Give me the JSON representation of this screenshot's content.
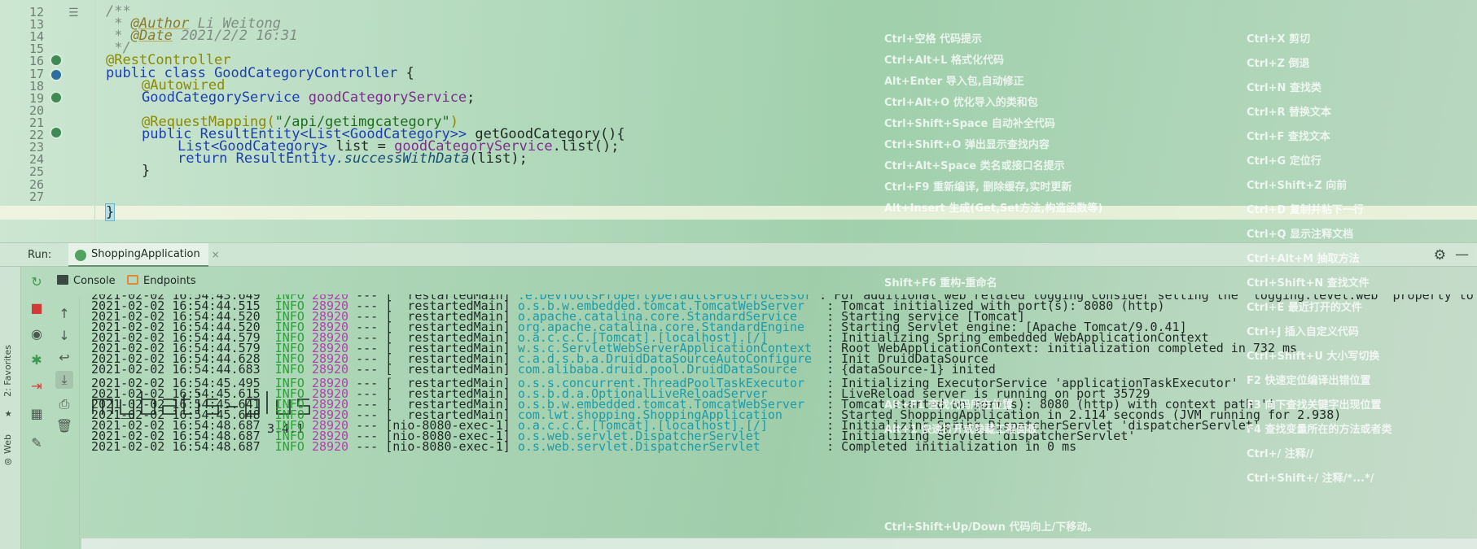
{
  "editor": {
    "line_numbers": [
      "12",
      "13",
      "14",
      "15",
      "16",
      "17",
      "18",
      "19",
      "20",
      "21",
      "22",
      "23",
      "24",
      "25",
      "26",
      "27"
    ],
    "lines": {
      "l12": "/**",
      "l13_prefix": " * ",
      "l13_tag": "@Author",
      "l13_val": " Li Weitong",
      "l14_prefix": " * ",
      "l14_tag": "@Date",
      "l14_val": " 2021/2/2 16:31",
      "l15": " */",
      "l16": "@RestController",
      "l17_kw": "public class ",
      "l17_cls": "GoodCategoryController",
      "l17_tail": " {",
      "l18": "@Autowired",
      "l19_type": "GoodCategoryService ",
      "l19_field": "goodCategoryService",
      "l19_tail": ";",
      "l21_ann": "@RequestMapping(",
      "l21_str": "\"/api/getimgcategory\"",
      "l21_tail": ")",
      "l22_kw": "public ",
      "l22_type": "ResultEntity<List<GoodCategory>> ",
      "l22_name": "getGoodCategory(){",
      "l23_type": "List<GoodCategory> ",
      "l23_var": "list = ",
      "l23_field": "goodCategoryService",
      "l23_tail": ".list();",
      "l24_kw": "return ",
      "l24_cls": "ResultEntity",
      "l24_mth": ".successWithData",
      "l24_tail": "(list);",
      "l25": "}",
      "l26": "}"
    }
  },
  "shortcuts": {
    "left": [
      "Ctrl+空格 代码提示",
      "Ctrl+Alt+L 格式化代码",
      "Alt+Enter 导入包,自动修正",
      "Ctrl+Alt+O 优化导入的类和包",
      "Ctrl+Shift+Space 自动补全代码",
      "Ctrl+Shift+O 弹出显示查找内容",
      "Ctrl+Alt+Space 类名或接口名提示",
      "Ctrl+F9 重新编译, 删除缓存,实时更新",
      "Alt+Insert 生成(Get,Set方法,构造函数等)",
      "Shift+F6 重构-重命名",
      "Alt+F1 查找代码所在位置",
      "Alt+1 快速打开或隐藏工程面板",
      "Ctrl+Shift+Up/Down 代码向上/下移动。"
    ],
    "right": [
      "Ctrl+X 剪切",
      "Ctrl+Z 倒退",
      "Ctrl+N 查找类",
      "Ctrl+R 替换文本",
      "Ctrl+F 查找文本",
      "Ctrl+G 定位行",
      "Ctrl+Shift+Z 向前",
      "Ctrl+D 复制并粘下一行",
      "Ctrl+Q 显示注释文档",
      "Ctrl+Alt+M 抽取方法",
      "Ctrl+Shift+N 查找文件",
      "Ctrl+E 最近打开的文件",
      "Ctrl+J 插入自定义代码",
      "Ctrl+Shift+U 大小写切换",
      "F2 快速定位编译出错位置",
      "F3 向下查找关键字出现位置",
      "F4 查找变量所在的方法或者类",
      "Ctrl+/ 注释//",
      "Ctrl+Shift+/ 注释/*...*/"
    ]
  },
  "run_bar": {
    "label": "Run:",
    "tab": "ShoppingApplication",
    "close": "×"
  },
  "console_tabs": {
    "console": "Console",
    "endpoints": "Endpoints"
  },
  "left_stripe": {
    "favorites": "2: Favorites",
    "web": "Web"
  },
  "log_cut": {
    "date": "2021-02-02 16:54:43.649",
    "lvl": "INFO",
    "pid": "28920",
    "sep": " --- [  ",
    "thr": "restartedMain]",
    "logger": ".e.DevToolsPropertyDefaultsPostProcessor",
    "msg": " : For additional web related logging consider setting the 'logging.level.web' property to"
  },
  "logs_a": [
    {
      "date": "2021-02-02 16:54:44.515",
      "lvl": "INFO",
      "pid": "28920",
      "thr": "restartedMain]",
      "logger": "o.s.b.w.embedded.tomcat.TomcatWebServer  ",
      "msg": "Tomcat initialized with port(s): 8080 (http)"
    },
    {
      "date": "2021-02-02 16:54:44.520",
      "lvl": "INFO",
      "pid": "28920",
      "thr": "restartedMain]",
      "logger": "o.apache.catalina.core.StandardService   ",
      "msg": "Starting service [Tomcat]"
    },
    {
      "date": "2021-02-02 16:54:44.520",
      "lvl": "INFO",
      "pid": "28920",
      "thr": "restartedMain]",
      "logger": "org.apache.catalina.core.StandardEngine  ",
      "msg": "Starting Servlet engine: [Apache Tomcat/9.0.41]"
    },
    {
      "date": "2021-02-02 16:54:44.579",
      "lvl": "INFO",
      "pid": "28920",
      "thr": "restartedMain]",
      "logger": "o.a.c.c.C.[Tomcat].[localhost].[/]       ",
      "msg": "Initializing Spring embedded WebApplicationContext"
    },
    {
      "date": "2021-02-02 16:54:44.579",
      "lvl": "INFO",
      "pid": "28920",
      "thr": "restartedMain]",
      "logger": "w.s.c.ServletWebServerApplicationContext ",
      "msg": "Root WebApplicationContext: initialization completed in 732 ms"
    },
    {
      "date": "2021-02-02 16:54:44.628",
      "lvl": "INFO",
      "pid": "28920",
      "thr": "restartedMain]",
      "logger": "c.a.d.s.b.a.DruidDataSourceAutoConfigure ",
      "msg": "Init DruidDataSource"
    },
    {
      "date": "2021-02-02 16:54:44.683",
      "lvl": "INFO",
      "pid": "28920",
      "thr": "restartedMain]",
      "logger": "com.alibaba.druid.pool.DruidDataSource   ",
      "msg": "{dataSource-1} inited"
    }
  ],
  "mybatis_plus": {
    "logo_text": "mybatis-plus",
    "version": "3.4.1"
  },
  "logs_b": [
    {
      "date": "2021-02-02 16:54:45.495",
      "lvl": "INFO",
      "pid": "28920",
      "thr": "[  restartedMain]",
      "logger": "o.s.s.concurrent.ThreadPoolTaskExecutor  ",
      "msg": "Initializing ExecutorService 'applicationTaskExecutor'"
    },
    {
      "date": "2021-02-02 16:54:45.615",
      "lvl": "INFO",
      "pid": "28920",
      "thr": "[  restartedMain]",
      "logger": "o.s.b.d.a.OptionalLiveReloadServer       ",
      "msg": "LiveReload server is running on port 35729"
    },
    {
      "date": "2021-02-02 16:54:45.641",
      "lvl": "INFO",
      "pid": "28920",
      "thr": "[  restartedMain]",
      "logger": "o.s.b.w.embedded.tomcat.TomcatWebServer  ",
      "msg": "Tomcat started on port(s): 8080 (http) with context path ''"
    },
    {
      "date": "2021-02-02 16:54:45.648",
      "lvl": "INFO",
      "pid": "28920",
      "thr": "[  restartedMain]",
      "logger": "com.lwt.shopping.ShoppingApplication     ",
      "msg": "Started ShoppingApplication in 2.114 seconds (JVM running for 2.938)"
    },
    {
      "date": "2021-02-02 16:54:48.687",
      "lvl": "INFO",
      "pid": "28920",
      "thr": "[nio-8080-exec-1]",
      "logger": "o.a.c.c.C.[Tomcat].[localhost].[/]       ",
      "msg": "Initializing Spring DispatcherServlet 'dispatcherServlet'"
    },
    {
      "date": "2021-02-02 16:54:48.687",
      "lvl": "INFO",
      "pid": "28920",
      "thr": "[nio-8080-exec-1]",
      "logger": "o.s.web.servlet.DispatcherServlet        ",
      "msg": "Initializing Servlet 'dispatcherServlet'"
    },
    {
      "date": "2021-02-02 16:54:48.687",
      "lvl": "INFO",
      "pid": "28920",
      "thr": "[nio-8080-exec-1]",
      "logger": "o.s.web.servlet.DispatcherServlet        ",
      "msg": "Completed initialization in 0 ms"
    }
  ],
  "icons": {
    "rerun": "rerun-icon",
    "stop": "stop-icon",
    "camera": "screenshot-icon",
    "debug": "debug-icon",
    "exit": "exit-icon",
    "layout": "layout-icon",
    "pin": "pin-icon",
    "up": "up-arrow-icon",
    "down": "down-arrow-icon",
    "wrap": "soft-wrap-icon",
    "scroll_end": "scroll-to-end-icon",
    "print": "print-icon",
    "trash": "trash-icon",
    "gear": "gear-icon",
    "minimize": "minimize-icon"
  },
  "colors": {
    "info": "#2f9e3a",
    "pid": "#b23fb0",
    "logger": "#1e9aa8",
    "keyword": "#1d3fb0",
    "string": "#1d6e1f"
  }
}
